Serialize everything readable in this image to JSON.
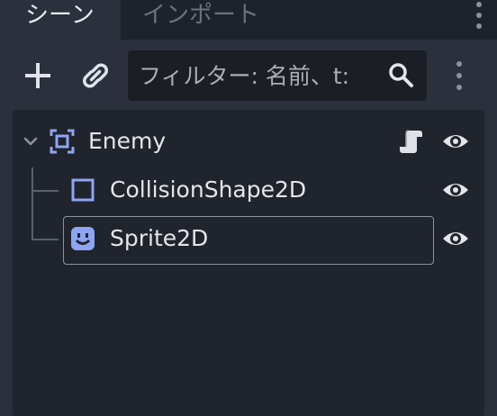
{
  "tabs": [
    {
      "label": "シーン",
      "active": true
    },
    {
      "label": "インポート",
      "active": false
    }
  ],
  "toolbar": {
    "add_icon": "plus-icon",
    "link_icon": "link-icon",
    "filter_placeholder": "フィルター: 名前、t:",
    "search_icon": "search-icon",
    "menu_icon": "kebab-menu-icon"
  },
  "tree": {
    "nodes": [
      {
        "label": "Enemy",
        "icon": "node2d-icon",
        "expanded": true,
        "has_script": true,
        "visible": true,
        "selected": false
      },
      {
        "label": "CollisionShape2D",
        "icon": "collision-shape-icon",
        "visible": true,
        "selected": false
      },
      {
        "label": "Sprite2D",
        "icon": "sprite2d-icon",
        "visible": true,
        "selected": true
      }
    ]
  },
  "colors": {
    "accent": "#8da5f3",
    "panel": "#2a303c",
    "tree_bg": "#20242c",
    "tab_bar": "#1e222a"
  }
}
